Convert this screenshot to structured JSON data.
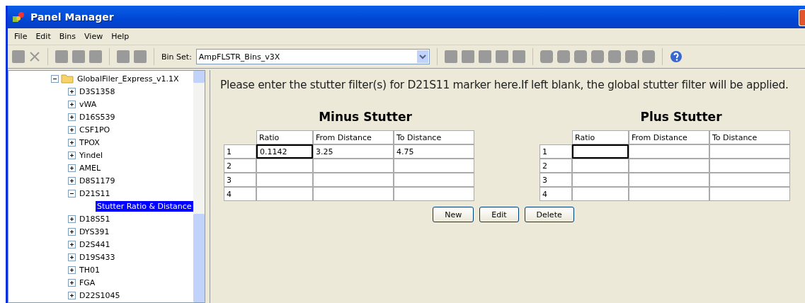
{
  "window": {
    "title": "Panel Manager"
  },
  "menu": [
    "File",
    "Edit",
    "Bins",
    "View",
    "Help"
  ],
  "toolbar": {
    "bin_set_label": "Bin Set:",
    "bin_set_value": "AmpFLSTR_Bins_v3X"
  },
  "tree": [
    {
      "label": "GlobalFiler_Express_v1.1X",
      "expanded": true,
      "selected": false,
      "children": [
        {
          "label": "D3S1358",
          "expanded": false,
          "selected": false
        },
        {
          "label": "vWA",
          "expanded": false,
          "selected": false
        },
        {
          "label": "D16S539",
          "expanded": false,
          "selected": false
        },
        {
          "label": "CSF1PO",
          "expanded": false,
          "selected": false
        },
        {
          "label": "TPOX",
          "expanded": false,
          "selected": false
        },
        {
          "label": "Yindel",
          "expanded": false,
          "selected": false
        },
        {
          "label": "AMEL",
          "expanded": false,
          "selected": false
        },
        {
          "label": "D8S1179",
          "expanded": false,
          "selected": false
        },
        {
          "label": "D21S11",
          "expanded": true,
          "selected": false,
          "children": [
            {
              "label": "Stutter Ratio & Distance",
              "selected": true
            }
          ]
        },
        {
          "label": "D18S51",
          "expanded": false,
          "selected": false
        },
        {
          "label": "DYS391",
          "expanded": false,
          "selected": false
        },
        {
          "label": "D2S441",
          "expanded": false,
          "selected": false
        },
        {
          "label": "D19S433",
          "expanded": false,
          "selected": false
        },
        {
          "label": "TH01",
          "expanded": false,
          "selected": false
        },
        {
          "label": "FGA",
          "expanded": false,
          "selected": false
        },
        {
          "label": "D22S1045",
          "expanded": false,
          "selected": false
        }
      ]
    }
  ],
  "instruction": "Please enter the stutter filter(s) for D21S11 marker here.If left blank, the global stutter filter will be applied.",
  "tables": [
    {
      "title": "Minus Stutter",
      "columns": [
        "Ratio",
        "From Distance",
        "To Distance"
      ],
      "rows": [
        {
          "number": "1",
          "cells": [
            {
              "value": "0.1142",
              "focused": true
            },
            {
              "value": "3.25",
              "focused": false
            },
            {
              "value": "4.75",
              "focused": false
            }
          ]
        },
        {
          "number": "2",
          "cells": [
            {
              "focused": false
            },
            {
              "focused": false
            },
            {
              "focused": false
            }
          ]
        },
        {
          "number": "3",
          "cells": [
            {
              "focused": false
            },
            {
              "focused": false
            },
            {
              "focused": false
            }
          ]
        },
        {
          "number": "4",
          "cells": [
            {
              "focused": false
            },
            {
              "focused": false
            },
            {
              "focused": false
            }
          ]
        }
      ]
    },
    {
      "title": "Plus Stutter",
      "columns": [
        "Ratio",
        "From Distance",
        "To Distance"
      ],
      "rows": [
        {
          "number": "1",
          "cells": [
            {
              "focused": true
            },
            {
              "focused": false
            },
            {
              "focused": false
            }
          ]
        },
        {
          "number": "2",
          "cells": [
            {
              "focused": false
            },
            {
              "focused": false
            },
            {
              "focused": false
            }
          ]
        },
        {
          "number": "3",
          "cells": [
            {
              "focused": false
            },
            {
              "focused": false
            },
            {
              "focused": false
            }
          ]
        },
        {
          "number": "4",
          "cells": [
            {
              "focused": false
            },
            {
              "focused": false
            },
            {
              "focused": false
            }
          ]
        }
      ]
    }
  ],
  "buttons": [
    "New",
    "Edit",
    "Delete"
  ]
}
